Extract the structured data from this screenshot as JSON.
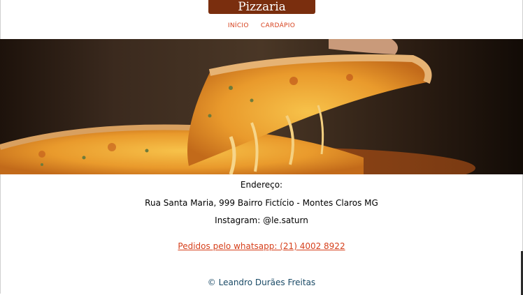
{
  "header": {
    "brand": "Pizzaria Unimontes",
    "nav": [
      {
        "label": "INÍCIO"
      },
      {
        "label": "CARDÁPIO"
      }
    ]
  },
  "info": {
    "address_label": "Endereço:",
    "address": "Rua Santa Maria, 999 Bairro Fictício - Montes Claros MG",
    "instagram": "Instagram: @le.saturn",
    "order_link": "Pedidos pelo whatsapp: (21) 4002 8922"
  },
  "footer": {
    "copyright": "© Leandro Durães Freitas"
  },
  "colors": {
    "brand_bg": "#7a2e0e",
    "link": "#d6401c",
    "footer_text": "#1a4a66"
  }
}
